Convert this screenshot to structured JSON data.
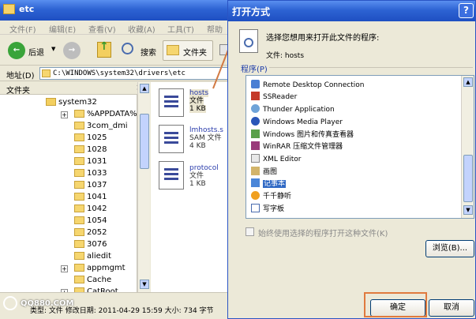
{
  "explorer": {
    "title": "etc",
    "menu": [
      "文件(F)",
      "编辑(E)",
      "查看(V)",
      "收藏(A)",
      "工具(T)",
      "帮助"
    ],
    "toolbar": {
      "back": "后退",
      "search": "搜索",
      "folders": "文件夹"
    },
    "address_label": "地址(D)",
    "address_value": "C:\\WINDOWS\\system32\\drivers\\etc",
    "folders_header": "文件夹",
    "tree_root": "system32",
    "tree": [
      "%APPDATA%",
      "3com_dmi",
      "1025",
      "1028",
      "1031",
      "1033",
      "1037",
      "1041",
      "1042",
      "1054",
      "2052",
      "3076",
      "aliedit",
      "appmgmt",
      "Cache",
      "CatRoot"
    ],
    "files": [
      {
        "name": "hosts",
        "type": "文件",
        "size": "1 KB"
      },
      {
        "name": "lmhosts.s",
        "type": "SAM 文件",
        "size": "4 KB"
      },
      {
        "name": "protocol",
        "type": "文件",
        "size": "1 KB"
      }
    ],
    "status": "类型: 文件 修改日期: 2011-04-29 15:59 大小: 734 字节",
    "watermark": "QQ880.COM"
  },
  "dialog": {
    "title": "打开方式",
    "help": "?",
    "prompt": "选择您想用来打开此文件的程序:",
    "file_label": "文件: hosts",
    "programs_label": "程序(P)",
    "programs": [
      "Remote Desktop Connection",
      "SSReader",
      "Thunder Application",
      "Windows Media Player",
      "Windows 图片和传真查看器",
      "WinRAR 压缩文件管理器",
      "XML Editor",
      "画图",
      "记事本",
      "千千静听",
      "写字板"
    ],
    "selected_program": "记事本",
    "always_use": "始终使用选择的程序打开这种文件(K)",
    "browse": "浏览(B)...",
    "ok": "确定",
    "cancel": "取消"
  },
  "colors": {
    "title_bar": "#2d63d3",
    "selection": "#316ac5",
    "highlight_box": "#e07a3e"
  }
}
